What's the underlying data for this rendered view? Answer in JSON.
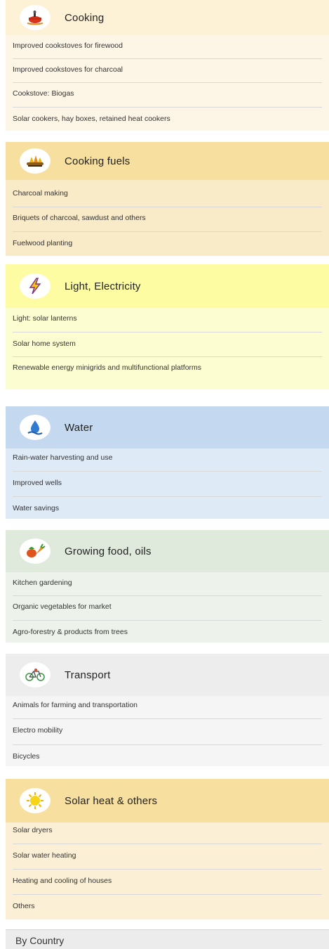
{
  "sections": [
    {
      "title": "Cooking",
      "icon": "cooking-pot-icon",
      "header_bg": "#fdf1d6",
      "body_bg": "#fdf6e7",
      "items": [
        "Improved cookstoves for firewood",
        "Improved cookstoves for charcoal",
        "Cookstove: Biogas",
        "Solar cookers, hay boxes, retained heat cookers"
      ]
    },
    {
      "title": "Cooking fuels",
      "icon": "fuel-wood-icon",
      "header_bg": "#f7dfa0",
      "body_bg": "#f9ebc8",
      "items": [
        "Charcoal making",
        "Briquets of charcoal, sawdust and others",
        "Fuelwood planting"
      ]
    },
    {
      "title": "Light, Electricity",
      "icon": "lightning-icon",
      "header_bg": "#fdfca2",
      "body_bg": "#fdfdd2",
      "items": [
        "Light: solar lanterns",
        "Solar home system",
        "Renewable energy minigrids and multifunctional platforms"
      ]
    },
    {
      "title": "Water",
      "icon": "water-drop-icon",
      "header_bg": "#c4d8ef",
      "body_bg": "#dfeaf7",
      "items": [
        "Rain-water harvesting and use",
        "Improved wells",
        "Water savings"
      ]
    },
    {
      "title": "Growing food, oils",
      "icon": "vegetables-icon",
      "header_bg": "#dfe9dc",
      "body_bg": "#edf3eb",
      "items": [
        "Kitchen gardening",
        "Organic vegetables for market",
        "Agro-forestry & products from trees"
      ]
    },
    {
      "title": "Transport",
      "icon": "bicycle-icon",
      "header_bg": "#ededed",
      "body_bg": "#f5f5f5",
      "items": [
        "Animals for farming and transportation",
        "Electro mobility",
        "Bicycles"
      ]
    },
    {
      "title": "Solar heat & others",
      "icon": "sun-icon",
      "header_bg": "#f7dfa0",
      "body_bg": "#fbf0d6",
      "items": [
        "Solar dryers",
        "Solar water heating",
        "Heating and cooling of houses",
        "Others"
      ]
    }
  ],
  "footer": {
    "label": "By Country"
  }
}
